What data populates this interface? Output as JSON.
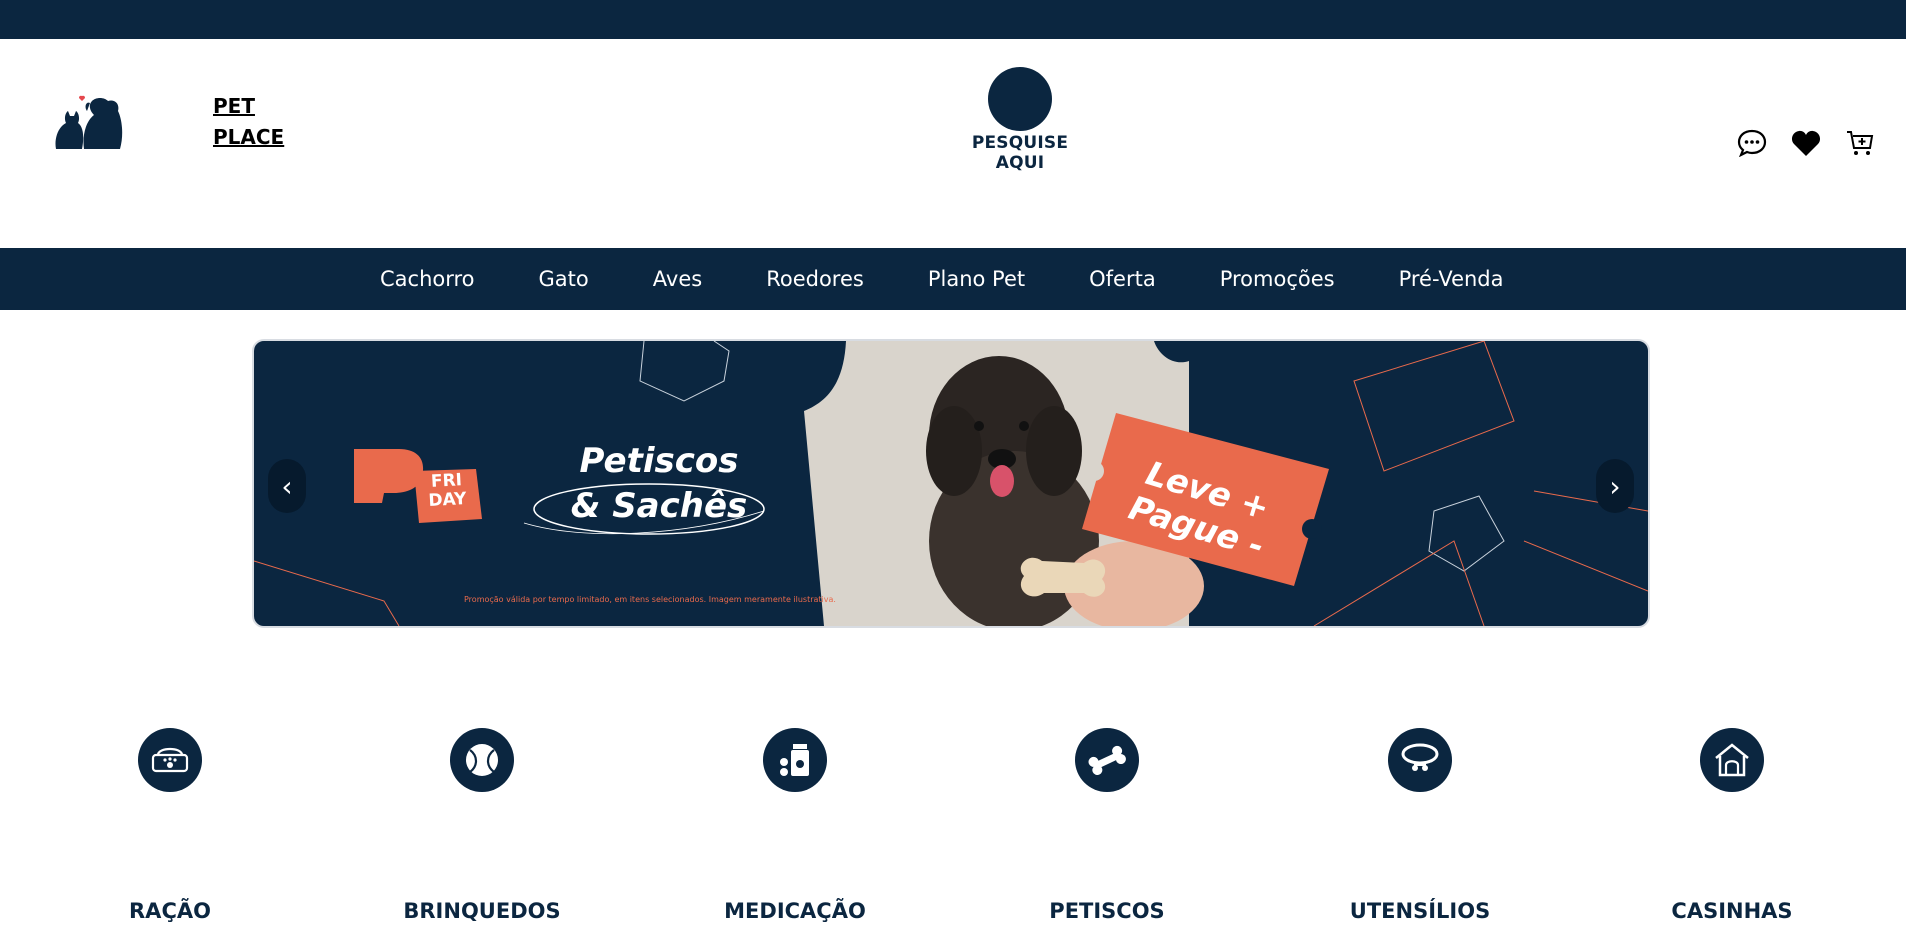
{
  "brand": {
    "line1": "PET",
    "line2": "PLACE"
  },
  "search": {
    "label": "PESQUISE AQUI"
  },
  "header_icons": [
    "chat-icon",
    "heart-icon",
    "cart-icon"
  ],
  "nav": {
    "items": [
      "Cachorro",
      "Gato",
      "Aves",
      "Roedores",
      "Plano Pet",
      "Oferta",
      "Promoções",
      "Pré-Venda"
    ]
  },
  "banner": {
    "badge_line1": "FRI",
    "badge_line2": "DAY",
    "title_line1": "Petiscos",
    "title_line2": "& Sachês",
    "offer_line1": "Leve +",
    "offer_line2": "Pague -",
    "note": "Promoção válida por tempo limitado, em itens selecionados. Imagem meramente ilustrativa.",
    "prev_label": "‹",
    "next_label": "›"
  },
  "categories": [
    {
      "label": "RAÇÃO",
      "icon": "food-bowl-icon"
    },
    {
      "label": "BRINQUEDOS",
      "icon": "ball-icon"
    },
    {
      "label": "MEDICAÇÃO",
      "icon": "medicine-icon"
    },
    {
      "label": "PETISCOS",
      "icon": "bone-icon"
    },
    {
      "label": "UTENSÍLIOS",
      "icon": "collar-icon"
    },
    {
      "label": "CASINHAS",
      "icon": "doghouse-icon"
    }
  ],
  "colors": {
    "navy": "#0b2640",
    "accent": "#e96a4c",
    "white": "#ffffff"
  }
}
